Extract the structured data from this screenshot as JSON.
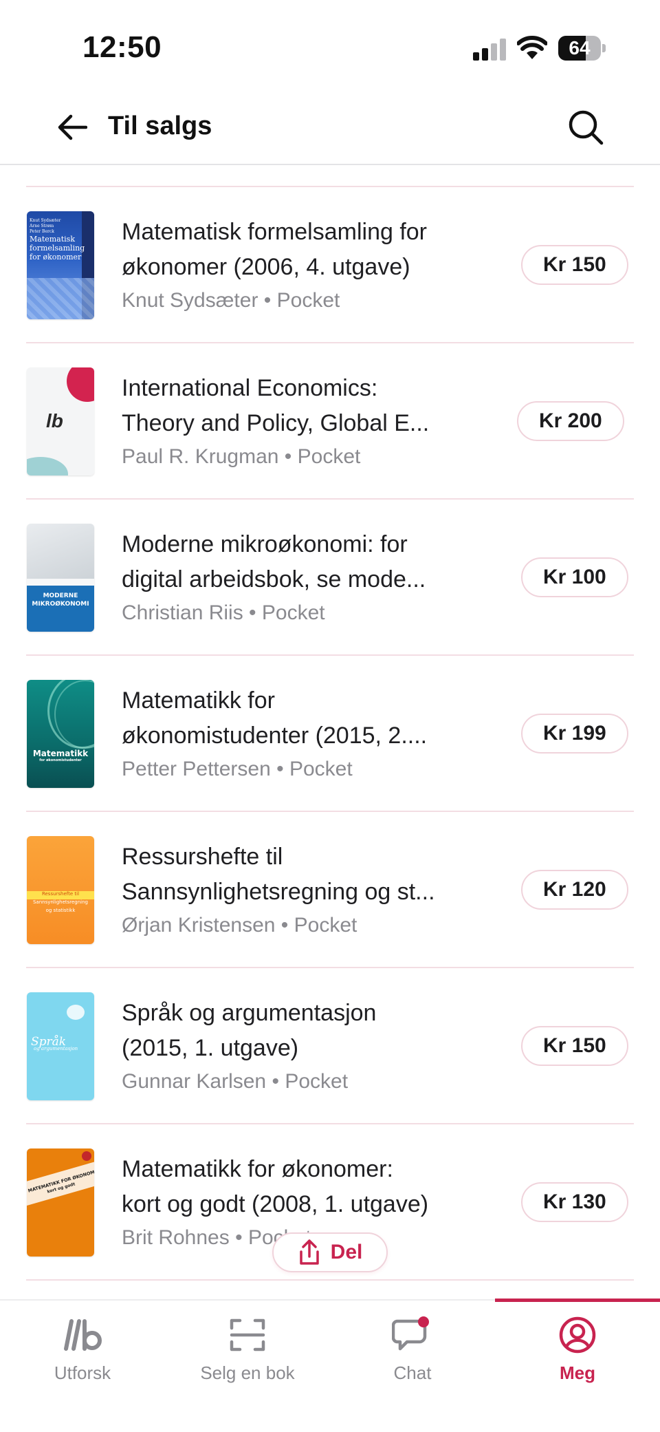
{
  "status_bar": {
    "time": "12:50",
    "battery": "64",
    "battery_level": 0.64
  },
  "header": {
    "title": "Til salgs",
    "back_icon": "arrow-left-icon",
    "search_icon": "search-icon"
  },
  "books": [
    {
      "title_line1": "Matematisk formelsamling for",
      "title_line2": "økonomer (2006, 4. utgave)",
      "author": "Knut Sydsæter",
      "format": "Pocket",
      "price": "Kr 150",
      "cover": {
        "lines": [
          "Knut Sydsæter",
          "Arne Strøm",
          "Peter Berck",
          "Matematisk",
          "formelsamling",
          "for økonomer"
        ]
      }
    },
    {
      "title_line1": "International Economics:",
      "title_line2": "Theory and Policy, Global E...",
      "author": "Paul R. Krugman",
      "format": "Pocket",
      "price": "Kr 200",
      "cover": {
        "lines": [
          "lb"
        ]
      }
    },
    {
      "title_line1": "Moderne mikroøkonomi: for",
      "title_line2": "digital arbeidsbok, se mode...",
      "author": "Christian Riis",
      "format": "Pocket",
      "price": "Kr 100",
      "cover": {
        "lines": [
          "MODERNE",
          "MIKROØKONOMI"
        ]
      }
    },
    {
      "title_line1": "Matematikk for",
      "title_line2": "økonomistudenter (2015, 2....",
      "author": "Petter Pettersen",
      "format": "Pocket",
      "price": "Kr 199",
      "cover": {
        "lines": [
          "Matematikk",
          "for økonomistudenter"
        ]
      }
    },
    {
      "title_line1": "Ressurshefte til",
      "title_line2": "Sannsynlighetsregning og st...",
      "author": "Ørjan Kristensen",
      "format": "Pocket",
      "price": "Kr 120",
      "cover": {
        "lines": [
          "Ressurshefte til",
          "Sannsynlighetsregning",
          "og statistikk"
        ]
      }
    },
    {
      "title_line1": "Språk og argumentasjon",
      "title_line2": "(2015, 1. utgave)",
      "author": "Gunnar Karlsen",
      "format": "Pocket",
      "price": "Kr 150",
      "cover": {
        "lines": [
          "Språk",
          "og argumentasjon"
        ]
      }
    },
    {
      "title_line1": "Matematikk for økonomer:",
      "title_line2": "kort og godt (2008, 1. utgave)",
      "author": "Brit Rohnes",
      "format": "Pocket",
      "price": "Kr 130",
      "cover": {
        "lines": [
          "MATEMATIKK FOR ØKONOMER",
          "kort og godt"
        ]
      }
    }
  ],
  "share": {
    "label": "Del",
    "icon": "share-icon"
  },
  "tabs": [
    {
      "label": "Utforsk",
      "icon": "lb-logo-icon",
      "active": false
    },
    {
      "label": "Selg en bok",
      "icon": "scan-icon",
      "active": false
    },
    {
      "label": "Chat",
      "icon": "chat-icon",
      "active": false,
      "badge": true
    },
    {
      "label": "Meg",
      "icon": "profile-icon",
      "active": true
    }
  ],
  "colors": {
    "accent": "#c8234f",
    "divider": "#f3dde3",
    "muted": "#8a8a8f"
  }
}
